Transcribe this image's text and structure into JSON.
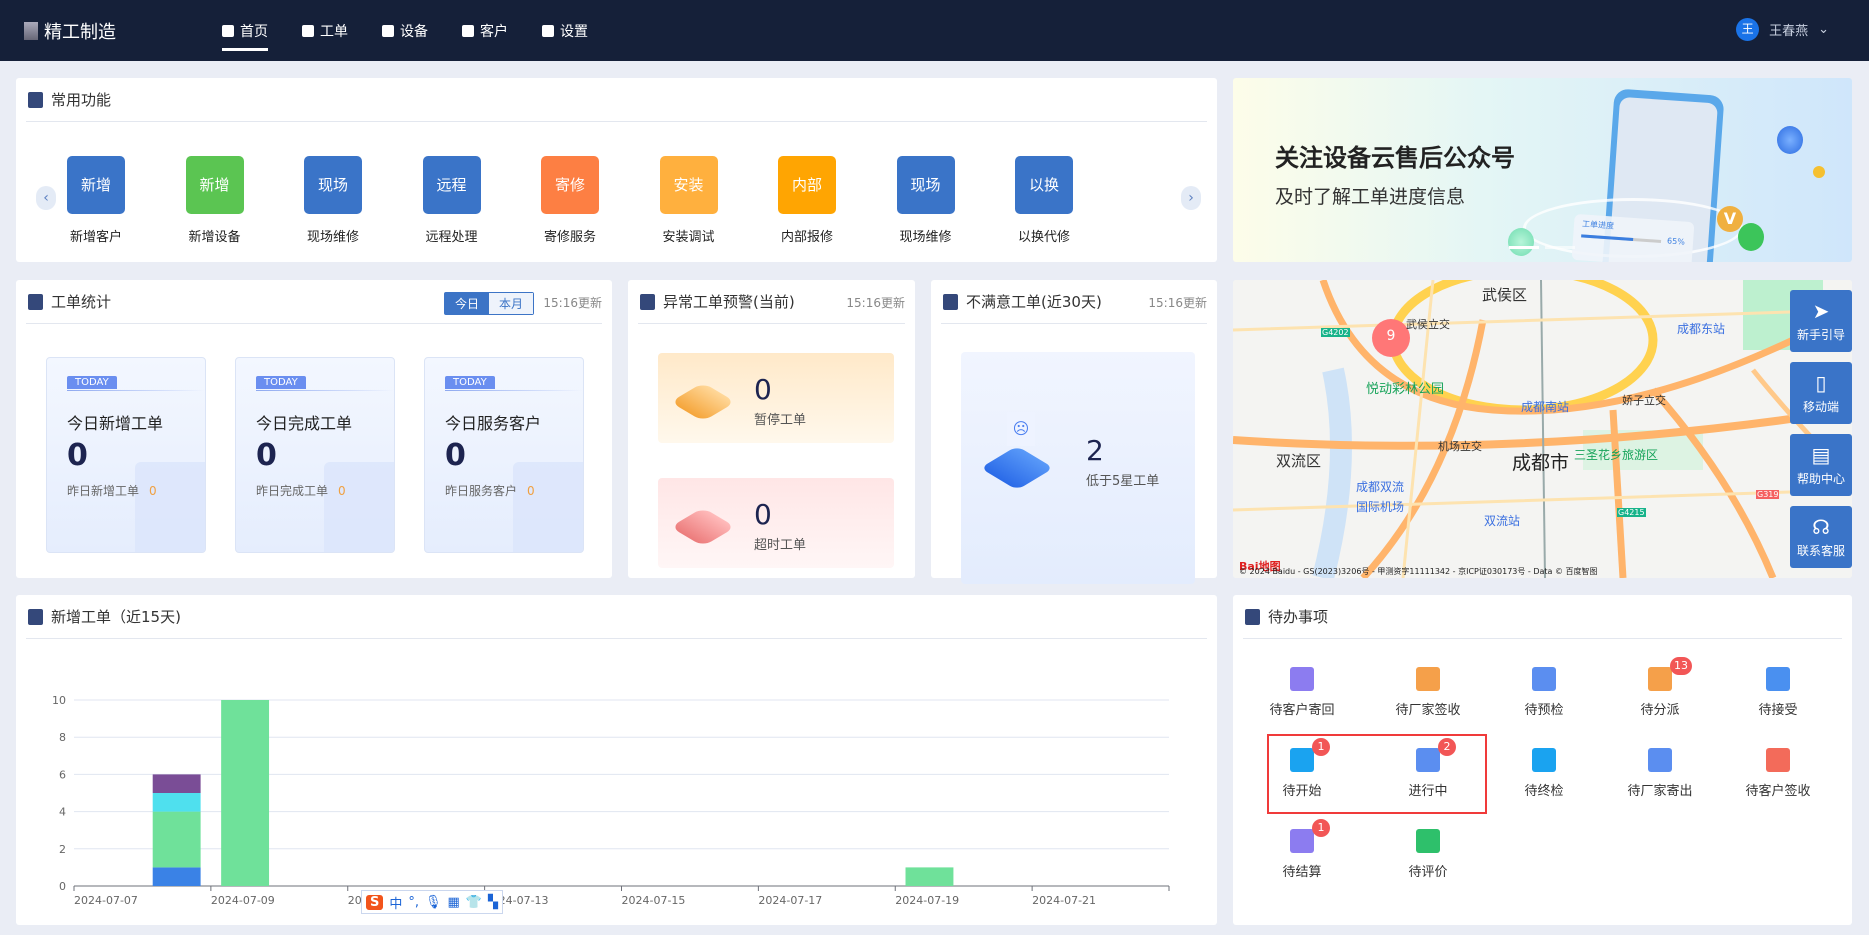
{
  "header": {
    "app_title": "精工制造",
    "nav": [
      {
        "label": "首页",
        "icon": "home-icon",
        "active": true
      },
      {
        "label": "工单",
        "icon": "workorder-icon"
      },
      {
        "label": "设备",
        "icon": "device-icon"
      },
      {
        "label": "客户",
        "icon": "customer-icon"
      },
      {
        "label": "设置",
        "icon": "gear-icon"
      }
    ],
    "user": {
      "avatar_text": "王",
      "name": "王春燕"
    }
  },
  "quick": {
    "title": "常用功能",
    "items": [
      {
        "tile": "新增",
        "label": "新增客户",
        "color": "#3a74c8"
      },
      {
        "tile": "新增",
        "label": "新增设备",
        "color": "#5bc552"
      },
      {
        "tile": "现场",
        "label": "现场维修",
        "color": "#3a74c8"
      },
      {
        "tile": "远程",
        "label": "远程处理",
        "color": "#3a74c8"
      },
      {
        "tile": "寄修",
        "label": "寄修服务",
        "color": "#fd7f43"
      },
      {
        "tile": "安装",
        "label": "安装调试",
        "color": "#ffb03e"
      },
      {
        "tile": "内部",
        "label": "内部报修",
        "color": "#ffa502"
      },
      {
        "tile": "现场",
        "label": "现场维修",
        "color": "#3a74c8"
      },
      {
        "tile": "以换",
        "label": "以换代修",
        "color": "#3a74c8"
      }
    ]
  },
  "banner": {
    "headline": "关注设备云售后公众号",
    "subline": "及时了解工单进度信息",
    "card_label": "工单进度",
    "card_percent": "65%",
    "progress": 0.65
  },
  "stats": {
    "title": "工单统计",
    "toggle": [
      "今日",
      "本月"
    ],
    "active_toggle": "今日",
    "updated": "15:16更新",
    "cards": [
      {
        "badge": "TODAY",
        "title": "今日新增工单",
        "value": "0",
        "sub_label": "昨日新增工单",
        "sub_value": "0"
      },
      {
        "badge": "TODAY",
        "title": "今日完成工单",
        "value": "0",
        "sub_label": "昨日完成工单",
        "sub_value": "0"
      },
      {
        "badge": "TODAY",
        "title": "今日服务客户",
        "value": "0",
        "sub_label": "昨日服务客户",
        "sub_value": "0"
      }
    ]
  },
  "abnormal": {
    "title": "异常工单预警(当前)",
    "updated": "15:16更新",
    "items": [
      {
        "value": "0",
        "label": "暂停工单"
      },
      {
        "value": "0",
        "label": "超时工单"
      }
    ]
  },
  "unsatisfied": {
    "title": "不满意工单(近30天)",
    "updated": "15:16更新",
    "value": "2",
    "label": "低于5星工单"
  },
  "map": {
    "cluster_count": "9",
    "labels": [
      "武侯区",
      "武侯立交",
      "悦动彩林公园",
      "成都南站",
      "成都东站",
      "娇子立交",
      "机场立交",
      "双流区",
      "成都市",
      "三圣花乡旅游区",
      "成都双流",
      "国际机场",
      "双流站",
      "G4202",
      "G319",
      "G4215"
    ],
    "copyright": "© 2024 Baidu - GS(2023)3206号 - 甲测资字11111342 - 京ICP证030173号 - Data © 百度智图",
    "logo": "Bai地图",
    "side_buttons": [
      {
        "label": "新手引导",
        "icon": "paper-plane-icon"
      },
      {
        "label": "移动端",
        "icon": "mobile-icon"
      },
      {
        "label": "帮助中心",
        "icon": "book-icon"
      },
      {
        "label": "联系客服",
        "icon": "headset-icon"
      }
    ]
  },
  "chart_panel": {
    "title": "新增工单（近15天)"
  },
  "chart_data": {
    "type": "bar",
    "stacked": true,
    "categories": [
      "2024-07-07",
      "2024-07-08",
      "2024-07-09",
      "2024-07-10",
      "2024-07-11",
      "2024-07-12",
      "2024-07-13",
      "2024-07-14",
      "2024-07-15",
      "2024-07-16",
      "2024-07-17",
      "2024-07-18",
      "2024-07-19",
      "2024-07-20",
      "2024-07-21",
      "2024-07-22"
    ],
    "tick_labels": [
      "2024-07-07",
      "2024-07-09",
      "2024-07-11",
      "2024-07-13",
      "2024-07-15",
      "2024-07-17",
      "2024-07-19",
      "2024-07-21"
    ],
    "series": [
      {
        "color": "#3a82e6",
        "values": [
          0,
          1,
          0,
          0,
          0,
          0,
          0,
          0,
          0,
          0,
          0,
          0,
          0,
          0,
          0,
          0
        ]
      },
      {
        "color": "#6fe19a",
        "values": [
          0,
          3,
          10,
          0,
          0,
          0,
          0,
          0,
          0,
          0,
          0,
          0,
          1,
          0,
          0,
          0
        ]
      },
      {
        "color": "#4fe0ee",
        "values": [
          0,
          1,
          0,
          0,
          0,
          0,
          0,
          0,
          0,
          0,
          0,
          0,
          0,
          0,
          0,
          0
        ]
      },
      {
        "color": "#7a4d96",
        "values": [
          0,
          1,
          0,
          0,
          0,
          0,
          0,
          0,
          0,
          0,
          0,
          0,
          0,
          0,
          0,
          0
        ]
      }
    ],
    "ylim": [
      0,
      10
    ],
    "yticks": [
      0,
      2,
      4,
      6,
      8,
      10
    ],
    "grid": true
  },
  "todo": {
    "title": "待办事项",
    "items": [
      {
        "label": "待客户寄回",
        "icon": "customer-return-icon",
        "color": "#8c7cf0"
      },
      {
        "label": "待厂家签收",
        "icon": "factory-sign-icon",
        "color": "#f5a04a"
      },
      {
        "label": "待预检",
        "icon": "precheck-icon",
        "color": "#5b8ef0"
      },
      {
        "label": "待分派",
        "icon": "dispatch-icon",
        "color": "#f5a04a",
        "badge": "13"
      },
      {
        "label": "待接受",
        "icon": "inbox-icon",
        "color": "#4a90f0"
      },
      {
        "label": "待开始",
        "icon": "calendar-play-icon",
        "color": "#1aa3f0",
        "badge": "1"
      },
      {
        "label": "进行中",
        "icon": "box-clock-icon",
        "color": "#5b8ef0",
        "badge": "2"
      },
      {
        "label": "待终检",
        "icon": "final-check-icon",
        "color": "#1aa3f0"
      },
      {
        "label": "待厂家寄出",
        "icon": "package-send-icon",
        "color": "#5b8ef0"
      },
      {
        "label": "待客户签收",
        "icon": "stamp-icon",
        "color": "#f36b5a"
      },
      {
        "label": "待结算",
        "icon": "settlement-icon",
        "color": "#8c7cf0",
        "badge": "1"
      },
      {
        "label": "待评价",
        "icon": "review-icon",
        "color": "#2ec06b"
      }
    ]
  }
}
